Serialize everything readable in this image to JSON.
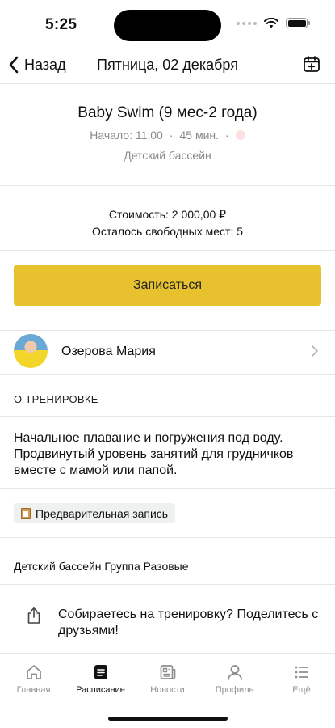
{
  "status_bar": {
    "time": "5:25"
  },
  "nav": {
    "back_label": "Назад",
    "title": "Пятница, 02 декабря"
  },
  "class": {
    "title": "Baby Swim (9 мес-2 года)",
    "start": "Начало: 11:00",
    "separator": "·",
    "duration": "45 мин.",
    "venue": "Детский бассейн"
  },
  "pricing": {
    "price": "Стоимость: 2 000,00 ₽",
    "spots": "Осталось свободных мест: 5"
  },
  "signup_label": "Записаться",
  "trainer": {
    "name": "Озерова  Мария"
  },
  "about": {
    "heading": "О ТРЕНИРОВКЕ",
    "description": "Начальное плавание и погружения под воду. Продвинутый уровень занятий для грудничков вместе с мамой или папой."
  },
  "tag": {
    "label": "Предварительная запись",
    "icon": "clipboard-icon"
  },
  "groups": "Детский бассейн Группа Разовые",
  "share": {
    "text": "Собираетесь на тренировку? Поделитесь с друзьями!"
  },
  "tabbar": {
    "items": [
      {
        "label": "Главная",
        "icon": "home-icon"
      },
      {
        "label": "Расписание",
        "icon": "schedule-icon",
        "active": true
      },
      {
        "label": "Новости",
        "icon": "news-icon"
      },
      {
        "label": "Профиль",
        "icon": "profile-icon"
      },
      {
        "label": "Ещё",
        "icon": "more-icon"
      }
    ]
  },
  "colors": {
    "accent": "#e8c22e",
    "muted": "#8a8a8a",
    "divider": "#e6e6e6"
  }
}
